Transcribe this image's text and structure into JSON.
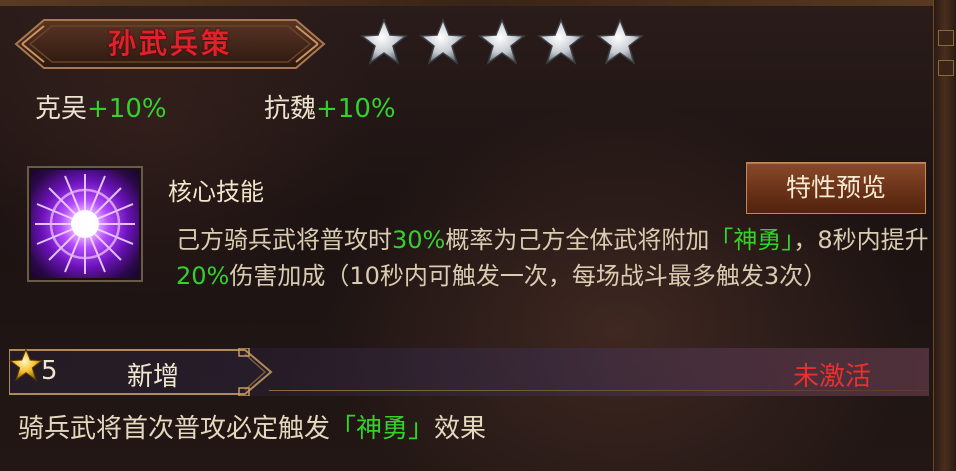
{
  "banner": {
    "title": "孙武兵策"
  },
  "stars": {
    "count": 5,
    "filled": 5
  },
  "bonuses": [
    {
      "label": "克吴",
      "value": "+10%"
    },
    {
      "label": "抗魏",
      "value": "+10%"
    }
  ],
  "skill": {
    "icon": "purple-burst-icon",
    "name": "核心技能",
    "preview_button": "特性预览",
    "description": {
      "p1": "己方骑兵武将普攻时",
      "chance": "30%",
      "p2": "概率为己方全体武将附加",
      "buff": "「神勇」",
      "p3": "，8秒内提升",
      "boost": "20%",
      "p4": "伤害加成（10秒内可触发一次，每场战斗最多触发3次）"
    }
  },
  "star_bonus": {
    "level": "5",
    "icon": "gold-star-icon",
    "label": "新增",
    "status": "未激活",
    "effect_p1": "骑兵武将首次普攻必定触发",
    "effect_buff": "「神勇」",
    "effect_p2": "效果"
  },
  "colors": {
    "green": "#33d12c",
    "red": "#e8302e",
    "title_red": "#e0202a"
  }
}
